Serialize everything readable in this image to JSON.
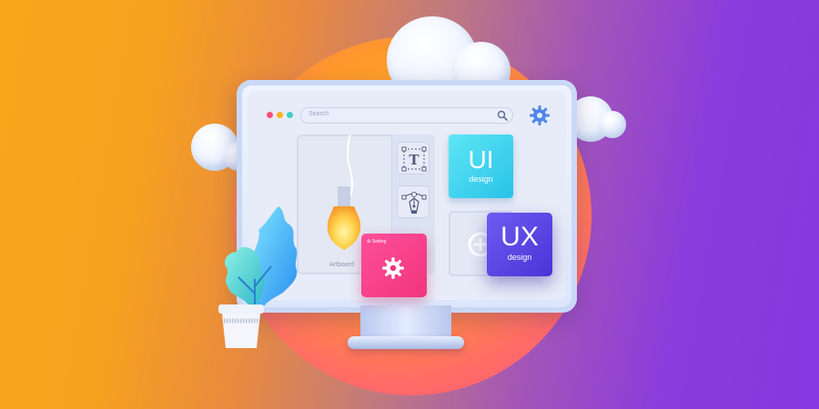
{
  "search": {
    "placeholder": "Search"
  },
  "window_dots": {
    "colors": [
      "#ff4f7a",
      "#ffb020",
      "#3fd0c8"
    ]
  },
  "canvas": {
    "artboard_label": "Artboard"
  },
  "cards": {
    "ui": {
      "title": "UI",
      "subtitle": "design"
    },
    "ux": {
      "title": "UX",
      "subtitle": "design"
    },
    "setting": {
      "label": "Setting"
    }
  },
  "tools": {
    "text_tool": "T",
    "icons": [
      "text-tool-icon",
      "pen-tool-icon",
      "add-icon",
      "gear-icon",
      "search-icon"
    ]
  },
  "colors": {
    "accent_ui": "#28c3e8",
    "accent_ux": "#4a33d6",
    "accent_setting": "#f0357e"
  }
}
